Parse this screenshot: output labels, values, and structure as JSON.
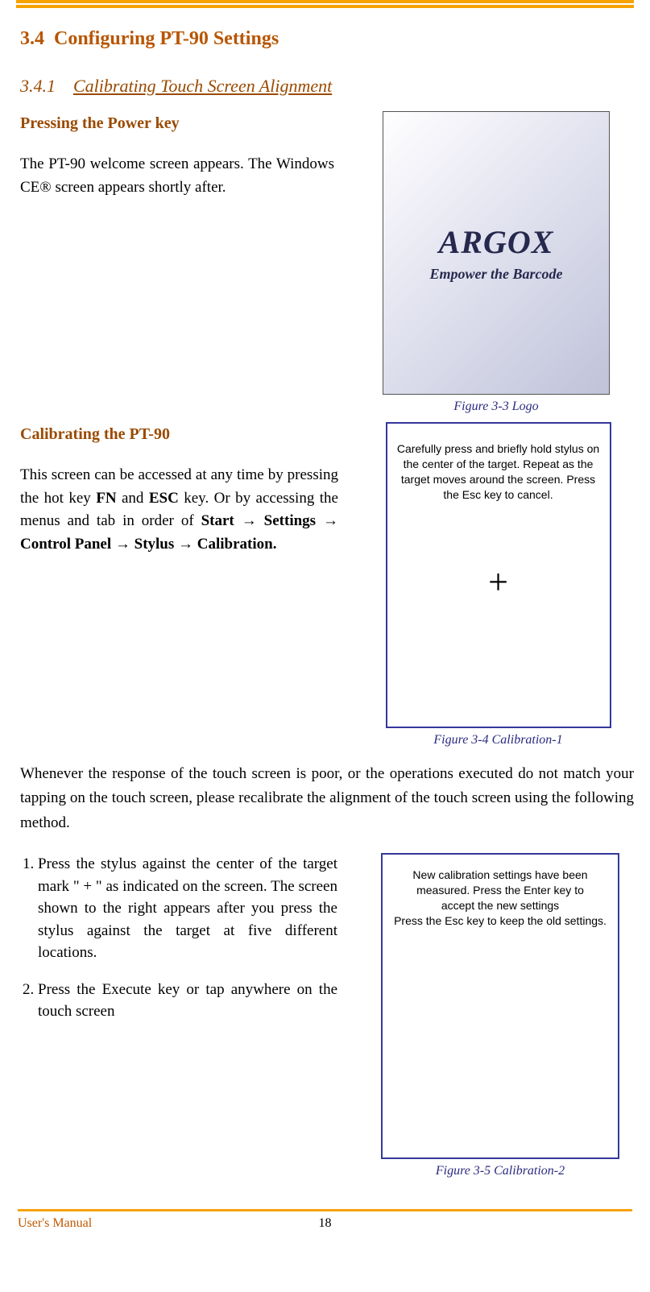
{
  "section": {
    "number": "3.4",
    "title": "Configuring PT-90 Settings"
  },
  "subsection": {
    "number": "3.4.1",
    "title": "Calibrating Touch Screen Alignment"
  },
  "block1": {
    "heading": "Pressing the Power key",
    "para": "The PT-90 welcome screen appears. The Windows CE® screen appears shortly after."
  },
  "fig1": {
    "brand": "ARGOX",
    "tagline": "Empower the Barcode",
    "caption": "Figure 3-3 Logo"
  },
  "block2": {
    "heading": "Calibrating the PT-90",
    "para_prefix": "This screen can be accessed at any time by pressing the hot key ",
    "key1": "FN",
    "mid1": " and ",
    "key2": "ESC",
    "mid2": " key. Or by accessing the menus and tab in order of  ",
    "nav_start": "Start",
    "nav_settings": "Settings",
    "nav_cp": "Control Panel",
    "nav_stylus": "Stylus",
    "nav_calib": "Calibration."
  },
  "fig2": {
    "msg": "Carefully press and briefly hold stylus on the center of the target. Repeat as the target moves around the screen. Press the Esc key to cancel.",
    "caption": "Figure 3-4 Calibration-1"
  },
  "midpara": "Whenever the response of the touch screen is poor, or the operations executed do not match your tapping on the touch screen, please recalibrate the alignment of the touch screen using the following method.",
  "steps": {
    "s1": "Press the stylus against the center of the target mark \" + \" as indicated on the screen. The screen shown to the right appears after you press the stylus against the target at five different locations.",
    "s2": "Press the Execute key or tap anywhere on the touch screen"
  },
  "fig3": {
    "msg_l1": "New calibration settings have been",
    "msg_l2": "measured. Press the Enter key to",
    "msg_l3": "accept the new settings",
    "msg_l4": "Press the Esc key to keep the old settings.",
    "caption": "Figure 3-5 Calibration-2"
  },
  "footer": {
    "text": "User's Manual",
    "page": "18"
  }
}
